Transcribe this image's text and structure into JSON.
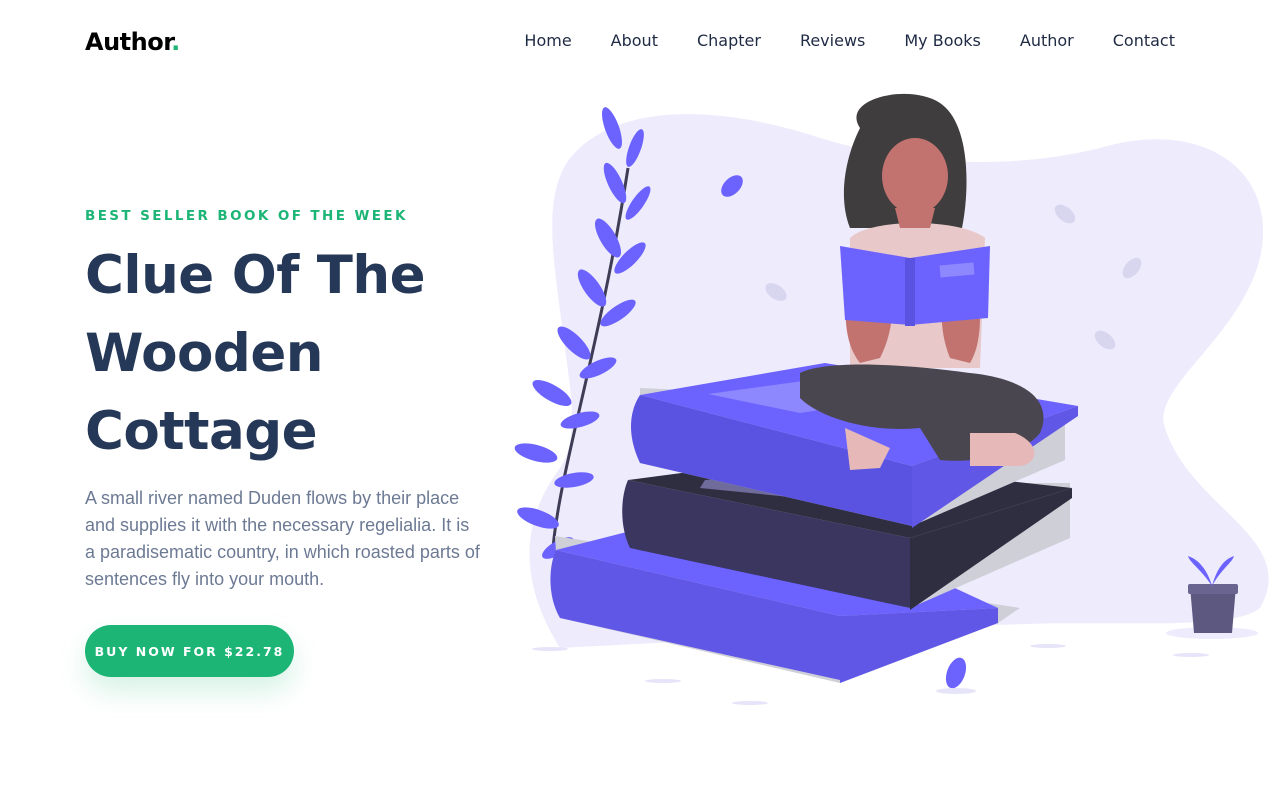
{
  "brand": {
    "name": "Author",
    "dot": ".",
    "accent": "#1cb576"
  },
  "nav": {
    "items": [
      {
        "label": "Home"
      },
      {
        "label": "About"
      },
      {
        "label": "Chapter"
      },
      {
        "label": "Reviews"
      },
      {
        "label": "My Books"
      },
      {
        "label": "Author"
      },
      {
        "label": "Contact"
      }
    ]
  },
  "hero": {
    "eyebrow": "BEST SELLER BOOK OF THE WEEK",
    "title_lines": [
      "Clue Of The",
      "Wooden",
      "Cottage"
    ],
    "description": "A small river named Duden flows by their place and supplies it with the necessary regelialia. It is a paradisematic country, in which roasted parts of sentences fly into your mouth.",
    "cta_label": "BUY NOW FOR $22.78"
  },
  "illustration": {
    "subject": "woman reading a book seated on a stack of books",
    "icons": [
      "leaf-icon",
      "plant-pot-icon"
    ],
    "colors": {
      "purple": "#6c63ff",
      "navy": "#2f2e41",
      "blob": "#eeebfd",
      "skin": "#c27370",
      "hair": "#3f3d3d"
    }
  }
}
